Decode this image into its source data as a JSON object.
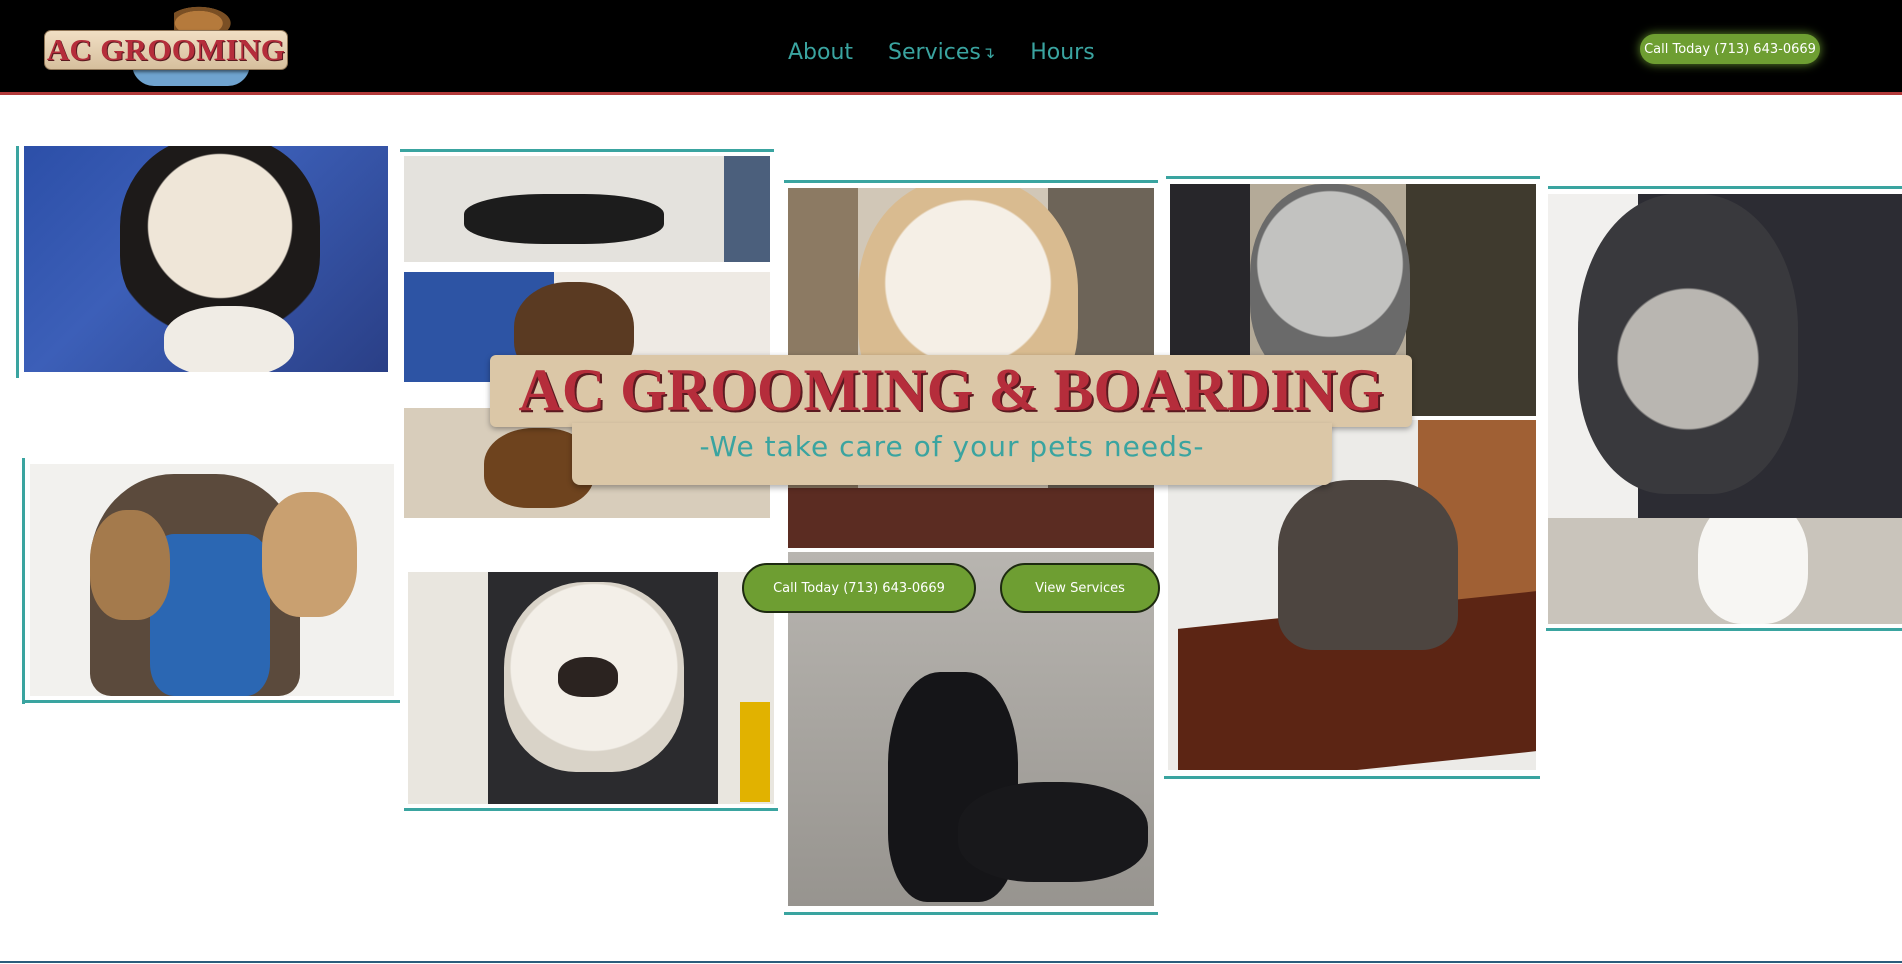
{
  "header": {
    "logo_text": "AC GROOMING",
    "nav": [
      {
        "label": "About"
      },
      {
        "label": "Services",
        "icon": "arrow-down-right-icon"
      },
      {
        "label": "Hours"
      }
    ],
    "cta_label": "Call Today (713) 643-0669"
  },
  "hero": {
    "title": "AC GROOMING & BOARDING",
    "subtitle": "-We take care of your pets needs-",
    "buttons": [
      {
        "label": "Call Today (713) 643-0669"
      },
      {
        "label": "View Services"
      }
    ]
  },
  "colors": {
    "header_bg": "#000000",
    "accent_teal": "#3aa4a0",
    "cta_green": "#6e9e32",
    "brand_red": "#b52d3b",
    "banner_tan": "#dbc7a7"
  }
}
